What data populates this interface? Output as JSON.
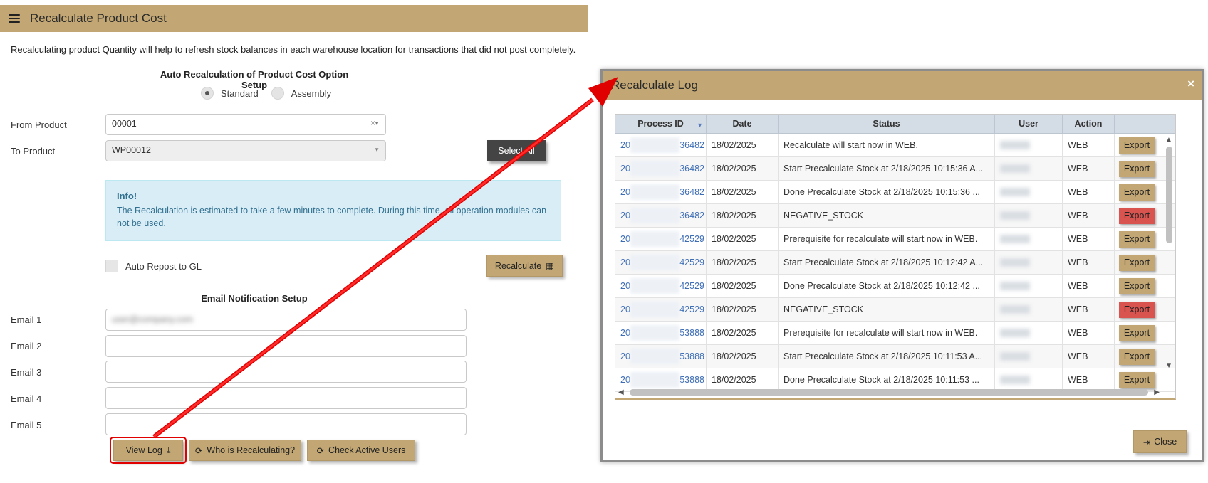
{
  "page": {
    "title": "Recalculate Product Cost",
    "intro": "Recalculating product Quantity will help to refresh stock balances in each warehouse location for transactions that did not post completely.",
    "option_title": "Auto Recalculation of Product Cost Option Setup",
    "options": [
      {
        "label": "Standard",
        "checked": true
      },
      {
        "label": "Assembly",
        "checked": false
      }
    ],
    "from_product_label": "From Product",
    "from_product_value": "00001",
    "to_product_label": "To Product",
    "to_product_value": "WP00012",
    "select_all_label": "Select All",
    "info_title": "Info!",
    "info_text": "The Recalculation is estimated to take a few minutes to complete. During this time, all operation modules can not be used.",
    "auto_repost_label": "Auto Repost to GL",
    "recalculate_label": "Recalculate",
    "email_title": "Email Notification Setup",
    "email_labels": [
      "Email 1",
      "Email 2",
      "Email 3",
      "Email 4",
      "Email 5"
    ],
    "email_values": [
      "user@company.com",
      "",
      "",
      "",
      ""
    ],
    "view_log_label": "View Log",
    "who_label": "Who is Recalculating?",
    "check_users_label": "Check Active Users"
  },
  "dialog": {
    "title": "Recalculate Log",
    "close_x": "×",
    "close_label": "Close",
    "columns": [
      "Process ID",
      "Date",
      "Status",
      "User",
      "Action"
    ],
    "rows": [
      {
        "pid_prefix": "20",
        "pid_suffix": "36482",
        "date": "18/02/2025",
        "status": "Recalculate will start now in WEB.",
        "user": "admin",
        "action": "WEB",
        "export": "Export",
        "alert": false
      },
      {
        "pid_prefix": "20",
        "pid_suffix": "36482",
        "date": "18/02/2025",
        "status": "Start Precalculate Stock at 2/18/2025 10:15:36 A...",
        "user": "admin",
        "action": "WEB",
        "export": "Export",
        "alert": false
      },
      {
        "pid_prefix": "20",
        "pid_suffix": "36482",
        "date": "18/02/2025",
        "status": "Done Precalculate Stock at 2/18/2025 10:15:36 ...",
        "user": "admin",
        "action": "WEB",
        "export": "Export",
        "alert": false
      },
      {
        "pid_prefix": "20",
        "pid_suffix": "36482",
        "date": "18/02/2025",
        "status": "NEGATIVE_STOCK",
        "user": "admin",
        "action": "WEB",
        "export": "Export",
        "alert": true
      },
      {
        "pid_prefix": "20",
        "pid_suffix": "42529",
        "date": "18/02/2025",
        "status": "Prerequisite for recalculate will start now in WEB.",
        "user": "admin",
        "action": "WEB",
        "export": "Export",
        "alert": false
      },
      {
        "pid_prefix": "20",
        "pid_suffix": "42529",
        "date": "18/02/2025",
        "status": "Start Precalculate Stock at 2/18/2025 10:12:42 A...",
        "user": "admin",
        "action": "WEB",
        "export": "Export",
        "alert": false
      },
      {
        "pid_prefix": "20",
        "pid_suffix": "42529",
        "date": "18/02/2025",
        "status": "Done Precalculate Stock at 2/18/2025 10:12:42 ...",
        "user": "admin",
        "action": "WEB",
        "export": "Export",
        "alert": false
      },
      {
        "pid_prefix": "20",
        "pid_suffix": "42529",
        "date": "18/02/2025",
        "status": "NEGATIVE_STOCK",
        "user": "admin",
        "action": "WEB",
        "export": "Export",
        "alert": true
      },
      {
        "pid_prefix": "20",
        "pid_suffix": "53888",
        "date": "18/02/2025",
        "status": "Prerequisite for recalculate will start now in WEB.",
        "user": "admin",
        "action": "WEB",
        "export": "Export",
        "alert": false
      },
      {
        "pid_prefix": "20",
        "pid_suffix": "53888",
        "date": "18/02/2025",
        "status": "Start Precalculate Stock at 2/18/2025 10:11:53 A...",
        "user": "admin",
        "action": "WEB",
        "export": "Export",
        "alert": false
      },
      {
        "pid_prefix": "20",
        "pid_suffix": "53888",
        "date": "18/02/2025",
        "status": "Done Precalculate Stock at 2/18/2025 10:11:53 ...",
        "user": "admin",
        "action": "WEB",
        "export": "Export",
        "alert": false
      }
    ]
  },
  "colors": {
    "accent_gold": "#c2a774",
    "alert_red": "#d9534f",
    "annotation_red": "#e00000",
    "link_blue": "#3d6db5"
  }
}
